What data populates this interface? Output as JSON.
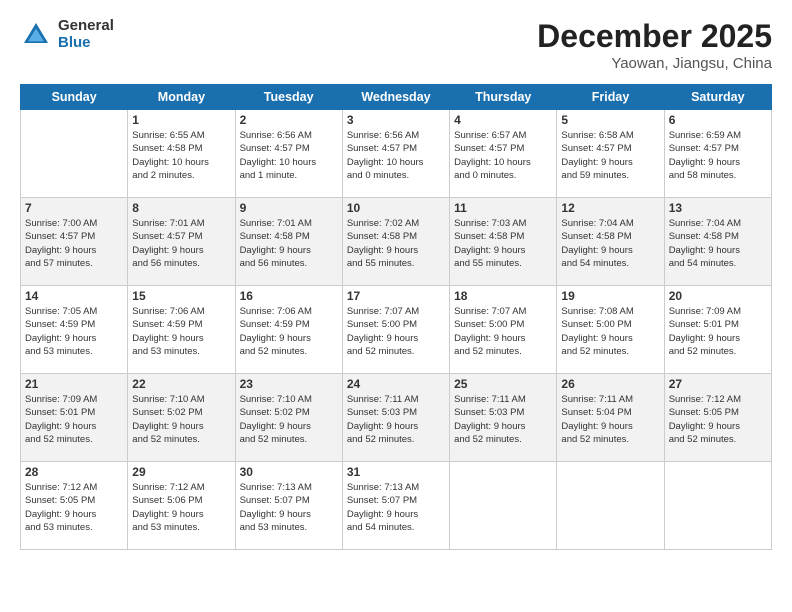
{
  "logo": {
    "general": "General",
    "blue": "Blue"
  },
  "title": "December 2025",
  "subtitle": "Yaowan, Jiangsu, China",
  "days_of_week": [
    "Sunday",
    "Monday",
    "Tuesday",
    "Wednesday",
    "Thursday",
    "Friday",
    "Saturday"
  ],
  "weeks": [
    [
      {
        "day": "",
        "info": ""
      },
      {
        "day": "1",
        "info": "Sunrise: 6:55 AM\nSunset: 4:58 PM\nDaylight: 10 hours\nand 2 minutes."
      },
      {
        "day": "2",
        "info": "Sunrise: 6:56 AM\nSunset: 4:57 PM\nDaylight: 10 hours\nand 1 minute."
      },
      {
        "day": "3",
        "info": "Sunrise: 6:56 AM\nSunset: 4:57 PM\nDaylight: 10 hours\nand 0 minutes."
      },
      {
        "day": "4",
        "info": "Sunrise: 6:57 AM\nSunset: 4:57 PM\nDaylight: 10 hours\nand 0 minutes."
      },
      {
        "day": "5",
        "info": "Sunrise: 6:58 AM\nSunset: 4:57 PM\nDaylight: 9 hours\nand 59 minutes."
      },
      {
        "day": "6",
        "info": "Sunrise: 6:59 AM\nSunset: 4:57 PM\nDaylight: 9 hours\nand 58 minutes."
      }
    ],
    [
      {
        "day": "7",
        "info": "Sunrise: 7:00 AM\nSunset: 4:57 PM\nDaylight: 9 hours\nand 57 minutes."
      },
      {
        "day": "8",
        "info": "Sunrise: 7:01 AM\nSunset: 4:57 PM\nDaylight: 9 hours\nand 56 minutes."
      },
      {
        "day": "9",
        "info": "Sunrise: 7:01 AM\nSunset: 4:58 PM\nDaylight: 9 hours\nand 56 minutes."
      },
      {
        "day": "10",
        "info": "Sunrise: 7:02 AM\nSunset: 4:58 PM\nDaylight: 9 hours\nand 55 minutes."
      },
      {
        "day": "11",
        "info": "Sunrise: 7:03 AM\nSunset: 4:58 PM\nDaylight: 9 hours\nand 55 minutes."
      },
      {
        "day": "12",
        "info": "Sunrise: 7:04 AM\nSunset: 4:58 PM\nDaylight: 9 hours\nand 54 minutes."
      },
      {
        "day": "13",
        "info": "Sunrise: 7:04 AM\nSunset: 4:58 PM\nDaylight: 9 hours\nand 54 minutes."
      }
    ],
    [
      {
        "day": "14",
        "info": "Sunrise: 7:05 AM\nSunset: 4:59 PM\nDaylight: 9 hours\nand 53 minutes."
      },
      {
        "day": "15",
        "info": "Sunrise: 7:06 AM\nSunset: 4:59 PM\nDaylight: 9 hours\nand 53 minutes."
      },
      {
        "day": "16",
        "info": "Sunrise: 7:06 AM\nSunset: 4:59 PM\nDaylight: 9 hours\nand 52 minutes."
      },
      {
        "day": "17",
        "info": "Sunrise: 7:07 AM\nSunset: 5:00 PM\nDaylight: 9 hours\nand 52 minutes."
      },
      {
        "day": "18",
        "info": "Sunrise: 7:07 AM\nSunset: 5:00 PM\nDaylight: 9 hours\nand 52 minutes."
      },
      {
        "day": "19",
        "info": "Sunrise: 7:08 AM\nSunset: 5:00 PM\nDaylight: 9 hours\nand 52 minutes."
      },
      {
        "day": "20",
        "info": "Sunrise: 7:09 AM\nSunset: 5:01 PM\nDaylight: 9 hours\nand 52 minutes."
      }
    ],
    [
      {
        "day": "21",
        "info": "Sunrise: 7:09 AM\nSunset: 5:01 PM\nDaylight: 9 hours\nand 52 minutes."
      },
      {
        "day": "22",
        "info": "Sunrise: 7:10 AM\nSunset: 5:02 PM\nDaylight: 9 hours\nand 52 minutes."
      },
      {
        "day": "23",
        "info": "Sunrise: 7:10 AM\nSunset: 5:02 PM\nDaylight: 9 hours\nand 52 minutes."
      },
      {
        "day": "24",
        "info": "Sunrise: 7:11 AM\nSunset: 5:03 PM\nDaylight: 9 hours\nand 52 minutes."
      },
      {
        "day": "25",
        "info": "Sunrise: 7:11 AM\nSunset: 5:03 PM\nDaylight: 9 hours\nand 52 minutes."
      },
      {
        "day": "26",
        "info": "Sunrise: 7:11 AM\nSunset: 5:04 PM\nDaylight: 9 hours\nand 52 minutes."
      },
      {
        "day": "27",
        "info": "Sunrise: 7:12 AM\nSunset: 5:05 PM\nDaylight: 9 hours\nand 52 minutes."
      }
    ],
    [
      {
        "day": "28",
        "info": "Sunrise: 7:12 AM\nSunset: 5:05 PM\nDaylight: 9 hours\nand 53 minutes."
      },
      {
        "day": "29",
        "info": "Sunrise: 7:12 AM\nSunset: 5:06 PM\nDaylight: 9 hours\nand 53 minutes."
      },
      {
        "day": "30",
        "info": "Sunrise: 7:13 AM\nSunset: 5:07 PM\nDaylight: 9 hours\nand 53 minutes."
      },
      {
        "day": "31",
        "info": "Sunrise: 7:13 AM\nSunset: 5:07 PM\nDaylight: 9 hours\nand 54 minutes."
      },
      {
        "day": "",
        "info": ""
      },
      {
        "day": "",
        "info": ""
      },
      {
        "day": "",
        "info": ""
      }
    ]
  ]
}
